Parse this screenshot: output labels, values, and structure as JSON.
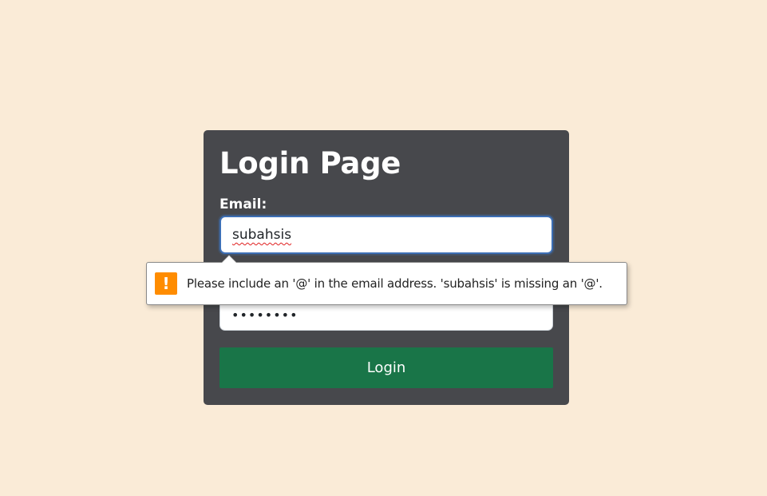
{
  "login": {
    "title": "Login Page",
    "email_label": "Email:",
    "email_value": "subahsis",
    "password_value": "••••••••",
    "login_button": "Login"
  },
  "validation": {
    "icon": "warning-icon",
    "icon_glyph": "!",
    "message": "Please include an '@' in the email address. 'subahsis' is missing an '@'.",
    "icon_color": "#ff8c00"
  },
  "colors": {
    "page_background": "#faebd7",
    "card_background": "#47484c",
    "button_background": "#197548",
    "focus_border": "#3d6fb5"
  }
}
